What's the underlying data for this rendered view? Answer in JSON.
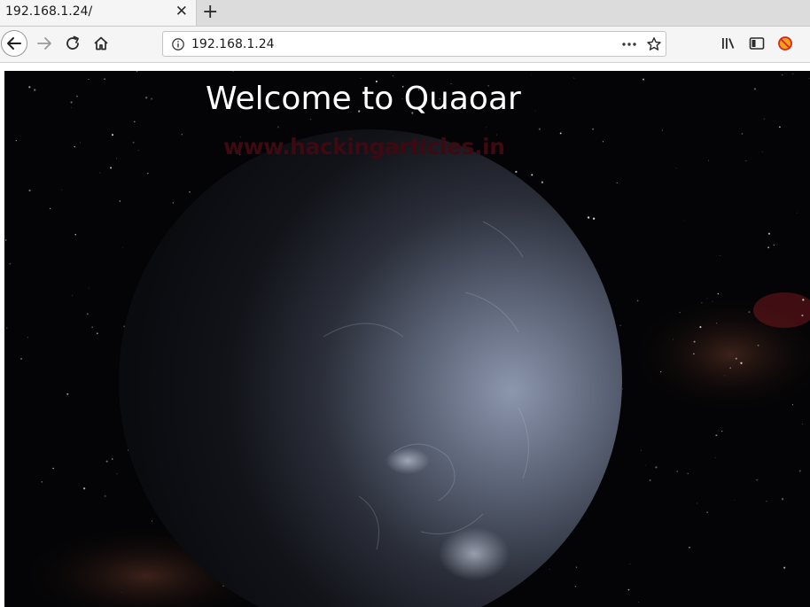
{
  "browser": {
    "tab": {
      "title": "192.168.1.24/",
      "close_glyph": "✕"
    },
    "new_tab_glyph": "+",
    "address_bar": {
      "url": "192.168.1.24"
    },
    "icons": {
      "back": "back-arrow-icon",
      "forward": "forward-arrow-icon",
      "reload": "reload-icon",
      "home": "home-icon",
      "site_info": "info-icon",
      "page_actions": "more-dots-icon",
      "bookmark": "star-icon",
      "library": "library-icon",
      "sidebar": "sidebar-icon",
      "extension": "blocked-extension-icon"
    }
  },
  "page": {
    "heading": "Welcome to Quaoar",
    "watermark": "www.hackingarticles.in",
    "colors": {
      "background": "#040406",
      "heading": "#ffffff",
      "watermark": "#3c0a10",
      "planet_light": "#8c96ad",
      "planet_dark": "#0a0b0f"
    }
  }
}
